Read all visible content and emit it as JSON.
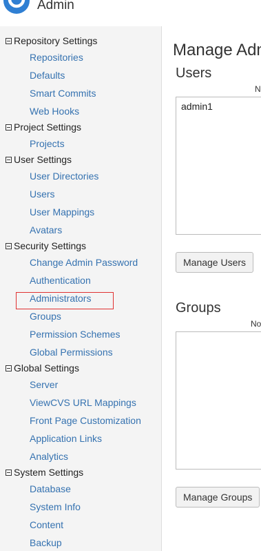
{
  "header": {
    "title": "Admin",
    "logo_icon": "circle-logo-icon"
  },
  "sidebar": {
    "sections": [
      {
        "label": "Repository Settings",
        "items": [
          "Repositories",
          "Defaults",
          "Smart Commits",
          "Web Hooks"
        ]
      },
      {
        "label": "Project Settings",
        "items": [
          "Projects"
        ]
      },
      {
        "label": "User Settings",
        "items": [
          "User Directories",
          "Users",
          "User Mappings",
          "Avatars"
        ]
      },
      {
        "label": "Security Settings",
        "items": [
          "Change Admin Password",
          "Authentication",
          "Administrators",
          "Groups",
          "Permission Schemes",
          "Global Permissions"
        ]
      },
      {
        "label": "Global Settings",
        "items": [
          "Server",
          "ViewCVS URL Mappings",
          "Front Page Customization",
          "Application Links",
          "Analytics"
        ]
      },
      {
        "label": "System Settings",
        "items": [
          "Database",
          "System Info",
          "Content",
          "Backup"
        ]
      }
    ],
    "selected": "Administrators"
  },
  "main": {
    "title": "Manage Adm",
    "users": {
      "heading": "Users",
      "column_label": "N",
      "entries": [
        "admin1"
      ],
      "button": "Manage Users"
    },
    "groups": {
      "heading": "Groups",
      "column_label": "No",
      "entries": [],
      "button": "Manage Groups"
    }
  },
  "colors": {
    "link": "#3572b0",
    "sidebar_bg": "#f4f4f4",
    "highlight": "#e03030",
    "logo": "#2f7fd3"
  }
}
